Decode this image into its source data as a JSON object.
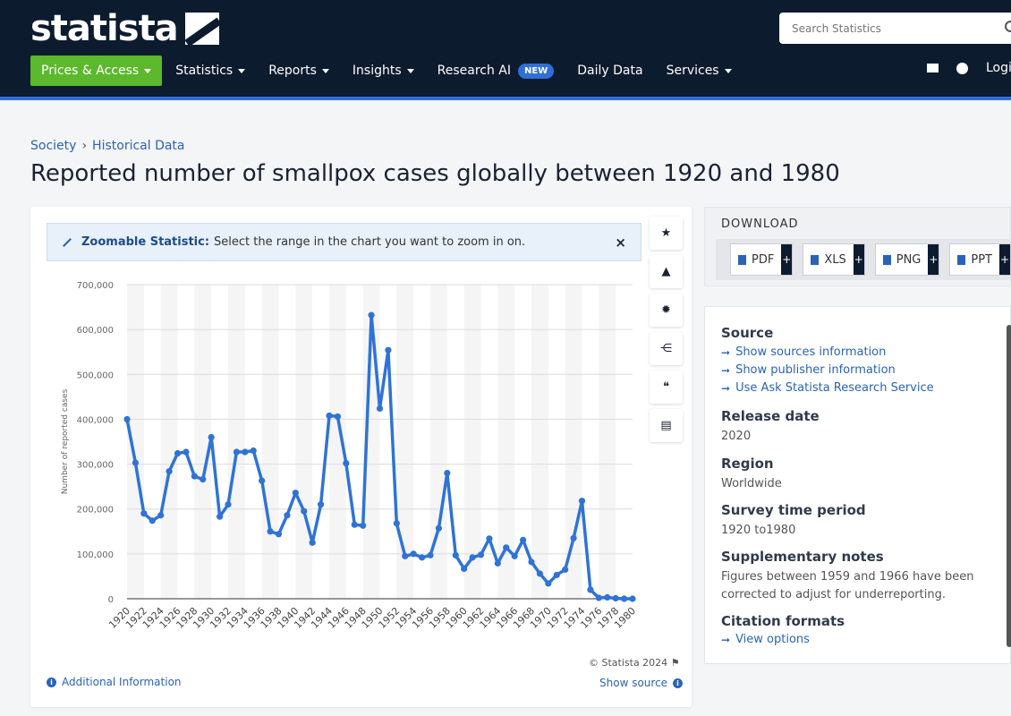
{
  "header": {
    "logo": "statista",
    "search_placeholder": "Search Statistics",
    "nav": [
      {
        "label": "Prices & Access",
        "caret": true
      },
      {
        "label": "Statistics",
        "caret": true
      },
      {
        "label": "Reports",
        "caret": true
      },
      {
        "label": "Insights",
        "caret": true
      },
      {
        "label": "Research AI",
        "badge": "NEW"
      },
      {
        "label": "Daily Data"
      },
      {
        "label": "Services",
        "caret": true
      }
    ],
    "login_label": "Login"
  },
  "breadcrumb": [
    "Society",
    "Historical Data"
  ],
  "page_title": "Reported number of smallpox cases globally between 1920 and 1980",
  "zoom_banner": {
    "bold": "Zoomable Statistic:",
    "text": "Select the range in the chart you want to zoom in on.",
    "close": "×"
  },
  "chart_footer": {
    "copyright": "© Statista 2024",
    "additional_info": "Additional Information",
    "show_source": "Show source"
  },
  "download": {
    "title": "DOWNLOAD",
    "buttons": [
      "PDF",
      "XLS",
      "PNG",
      "PPT"
    ]
  },
  "info": {
    "source_title": "Source",
    "source_links": [
      "Show sources information",
      "Show publisher information",
      "Use Ask Statista Research Service"
    ],
    "release_title": "Release date",
    "release_value": "2020",
    "region_title": "Region",
    "region_value": "Worldwide",
    "period_title": "Survey time period",
    "period_value": "1920 to1980",
    "notes_title": "Supplementary notes",
    "notes_line1": "Figures between 1959 and 1966 have been",
    "notes_line2": "corrected to adjust for underreporting.",
    "citation_title": "Citation formats",
    "citation_link": "View options"
  },
  "colors": {
    "accent": "#2a63b8",
    "line": "#2f73d6",
    "nav_bg": "#0d1b2e",
    "prices_bg": "#5cb82c"
  },
  "chart_data": {
    "type": "line",
    "title": "",
    "xlabel": "",
    "ylabel": "Number of reported cases",
    "ylim": [
      0,
      700000
    ],
    "yticks": [
      "0",
      "100,000",
      "200,000",
      "300,000",
      "400,000",
      "500,000",
      "600,000",
      "700,000"
    ],
    "xticks": [
      "1920",
      "1922",
      "1924",
      "1926",
      "1928",
      "1930",
      "1932",
      "1934",
      "1936",
      "1938",
      "1940",
      "1942",
      "1944",
      "1946",
      "1948",
      "1950",
      "1952",
      "1954",
      "1956",
      "1958",
      "1960",
      "1962",
      "1964",
      "1966",
      "1968",
      "1970",
      "1972",
      "1974",
      "1976",
      "1978",
      "1980"
    ],
    "grid": true,
    "series": [
      {
        "x": [
          1920,
          1921,
          1922,
          1923,
          1924,
          1925,
          1926,
          1927,
          1928,
          1929,
          1930,
          1931,
          1932,
          1933,
          1934,
          1935,
          1936,
          1937,
          1938,
          1939,
          1940,
          1941,
          1942,
          1943,
          1944,
          1945,
          1946,
          1947,
          1948,
          1949,
          1950,
          1951,
          1952,
          1953,
          1954,
          1955,
          1956,
          1957,
          1958,
          1959,
          1960,
          1961,
          1962,
          1963,
          1964,
          1965,
          1966,
          1967,
          1968,
          1969,
          1970,
          1971,
          1972,
          1973,
          1974,
          1975,
          1976,
          1977,
          1978,
          1979,
          1980
        ],
        "values": [
          400000,
          303000,
          190000,
          174000,
          186000,
          284000,
          324000,
          327000,
          273000,
          266000,
          360000,
          183000,
          210000,
          327000,
          327000,
          330000,
          263000,
          150000,
          144000,
          186000,
          236000,
          195000,
          125000,
          210000,
          408000,
          406000,
          302000,
          165000,
          163000,
          632000,
          424000,
          554000,
          168000,
          95000,
          100000,
          92000,
          97000,
          157000,
          280000,
          97000,
          67000,
          92000,
          98000,
          134000,
          79000,
          114000,
          95000,
          131000,
          82000,
          56000,
          34000,
          53000,
          65000,
          135000,
          218000,
          20000,
          2000,
          3000,
          1000,
          0,
          0
        ]
      }
    ]
  }
}
